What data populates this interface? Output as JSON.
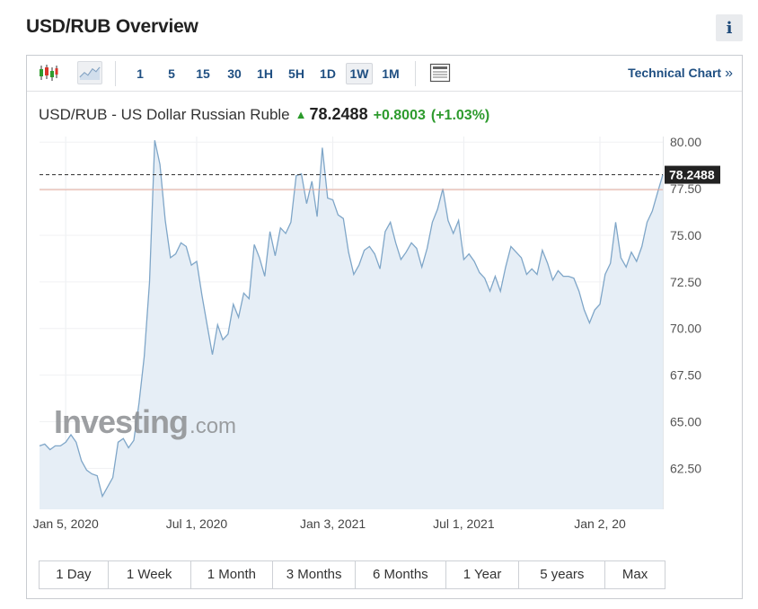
{
  "page": {
    "title": "USD/RUB Overview",
    "info_label": "i"
  },
  "toolbar": {
    "intervals": [
      "1",
      "5",
      "15",
      "30",
      "1H",
      "5H",
      "1D",
      "1W",
      "1M"
    ],
    "active_interval": "1W",
    "technical_chart_label": "Technical Chart",
    "technical_chart_arrow": "»",
    "icons": [
      "candlestick-icon",
      "area-chart-icon",
      "news-layout-icon"
    ]
  },
  "quote": {
    "name": "USD/RUB - US Dollar Russian Ruble",
    "price": "78.2488",
    "change": "+0.8003",
    "change_pct": "(+1.03%)"
  },
  "watermark": {
    "brand": "Investing",
    "suffix": ".com"
  },
  "ranges": [
    "1 Day",
    "1 Week",
    "1 Month",
    "3 Months",
    "6 Months",
    "1 Year",
    "5 years",
    "Max"
  ],
  "colors": {
    "line": "#7fa6c8",
    "fill": "#e6eef6",
    "up": "#2e9b2e",
    "link": "#1f4f82",
    "ref_line": "#e4a99b"
  },
  "chart_data": {
    "type": "area",
    "title": "",
    "xlabel": "",
    "ylabel": "",
    "x_tick_labels": [
      "Jan 5, 2020",
      "Jul 1, 2020",
      "Jan 3, 2021",
      "Jul 1, 2021",
      "Jan 2, 20"
    ],
    "x_tick_index": [
      5,
      30,
      56,
      81,
      107
    ],
    "y_ticks": [
      "80.00",
      "77.50",
      "75.00",
      "72.50",
      "70.00",
      "67.50",
      "65.00",
      "62.50"
    ],
    "ylim": [
      60.3,
      80.3
    ],
    "last_value_label": "78.2488",
    "last_value": 78.2488,
    "previous_close": 77.45,
    "series": [
      {
        "values": [
          63.7,
          63.8,
          63.5,
          63.7,
          63.7,
          63.9,
          64.3,
          63.9,
          62.9,
          62.4,
          62.2,
          62.1,
          61.0,
          61.5,
          62.0,
          63.9,
          64.1,
          63.6,
          64.0,
          66.0,
          68.5,
          72.5,
          80.1,
          78.8,
          75.8,
          73.8,
          74.0,
          74.6,
          74.4,
          73.4,
          73.6,
          71.8,
          70.2,
          68.6,
          70.2,
          69.4,
          69.7,
          71.3,
          70.6,
          71.9,
          71.6,
          74.5,
          73.8,
          72.8,
          75.2,
          73.9,
          75.4,
          75.1,
          75.7,
          78.2,
          78.3,
          76.7,
          77.9,
          76.0,
          79.7,
          77.0,
          76.9,
          76.1,
          75.9,
          74.1,
          72.9,
          73.4,
          74.2,
          74.4,
          74.0,
          73.2,
          75.2,
          75.7,
          74.6,
          73.7,
          74.1,
          74.6,
          74.3,
          73.3,
          74.3,
          75.7,
          76.4,
          77.5,
          75.8,
          75.1,
          75.8,
          73.7,
          74.0,
          73.6,
          73.0,
          72.7,
          72.0,
          72.8,
          72.0,
          73.3,
          74.4,
          74.1,
          73.8,
          72.9,
          73.2,
          72.9,
          74.2,
          73.5,
          72.6,
          73.1,
          72.8,
          72.8,
          72.7,
          72.0,
          71.0,
          70.3,
          71.0,
          71.3,
          72.9,
          73.5,
          75.7,
          73.8,
          73.3,
          74.1,
          73.6,
          74.4,
          75.7,
          76.3,
          77.3,
          78.2488
        ]
      }
    ]
  }
}
